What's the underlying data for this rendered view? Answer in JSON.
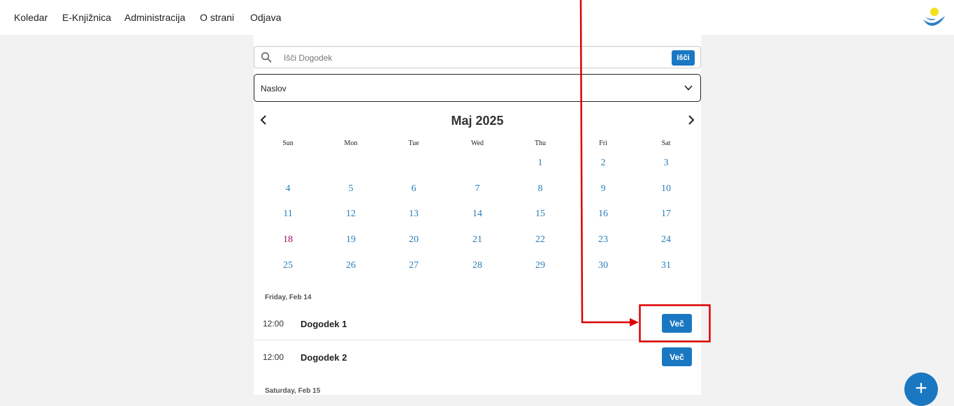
{
  "nav": {
    "items": [
      {
        "label": "Koledar"
      },
      {
        "label": "E-Knjižnica"
      },
      {
        "label": "Administracija"
      },
      {
        "label": "O strani"
      },
      {
        "label": "Odjava"
      }
    ]
  },
  "search": {
    "placeholder": "Išči Dogodek",
    "value": "",
    "button_label": "Išči"
  },
  "sort_select": {
    "selected": "Naslov"
  },
  "calendar": {
    "month_title": "Maj 2025",
    "weekdays": [
      "Sun",
      "Mon",
      "Tue",
      "Wed",
      "Thu",
      "Fri",
      "Sat"
    ],
    "weeks": [
      [
        "",
        "",
        "",
        "",
        "1",
        "2",
        "3"
      ],
      [
        "4",
        "5",
        "6",
        "7",
        "8",
        "9",
        "10"
      ],
      [
        "11",
        "12",
        "13",
        "14",
        "15",
        "16",
        "17"
      ],
      [
        "18",
        "19",
        "20",
        "21",
        "22",
        "23",
        "24"
      ],
      [
        "25",
        "26",
        "27",
        "28",
        "29",
        "30",
        "31"
      ]
    ],
    "today": "18"
  },
  "events": {
    "groups": [
      {
        "date_label": "Friday, Feb 14",
        "items": [
          {
            "time": "12:00",
            "title": "Dogodek 1",
            "button_label": "Več"
          },
          {
            "time": "12:00",
            "title": "Dogodek 2",
            "button_label": "Več"
          }
        ]
      },
      {
        "date_label": "Saturday, Feb 15",
        "items": []
      }
    ]
  },
  "fab": {
    "label": "+"
  },
  "colors": {
    "accent": "#1a78c2",
    "day_link": "#2a7fb8",
    "today": "#a0106a",
    "annotation": "#dd0000"
  }
}
